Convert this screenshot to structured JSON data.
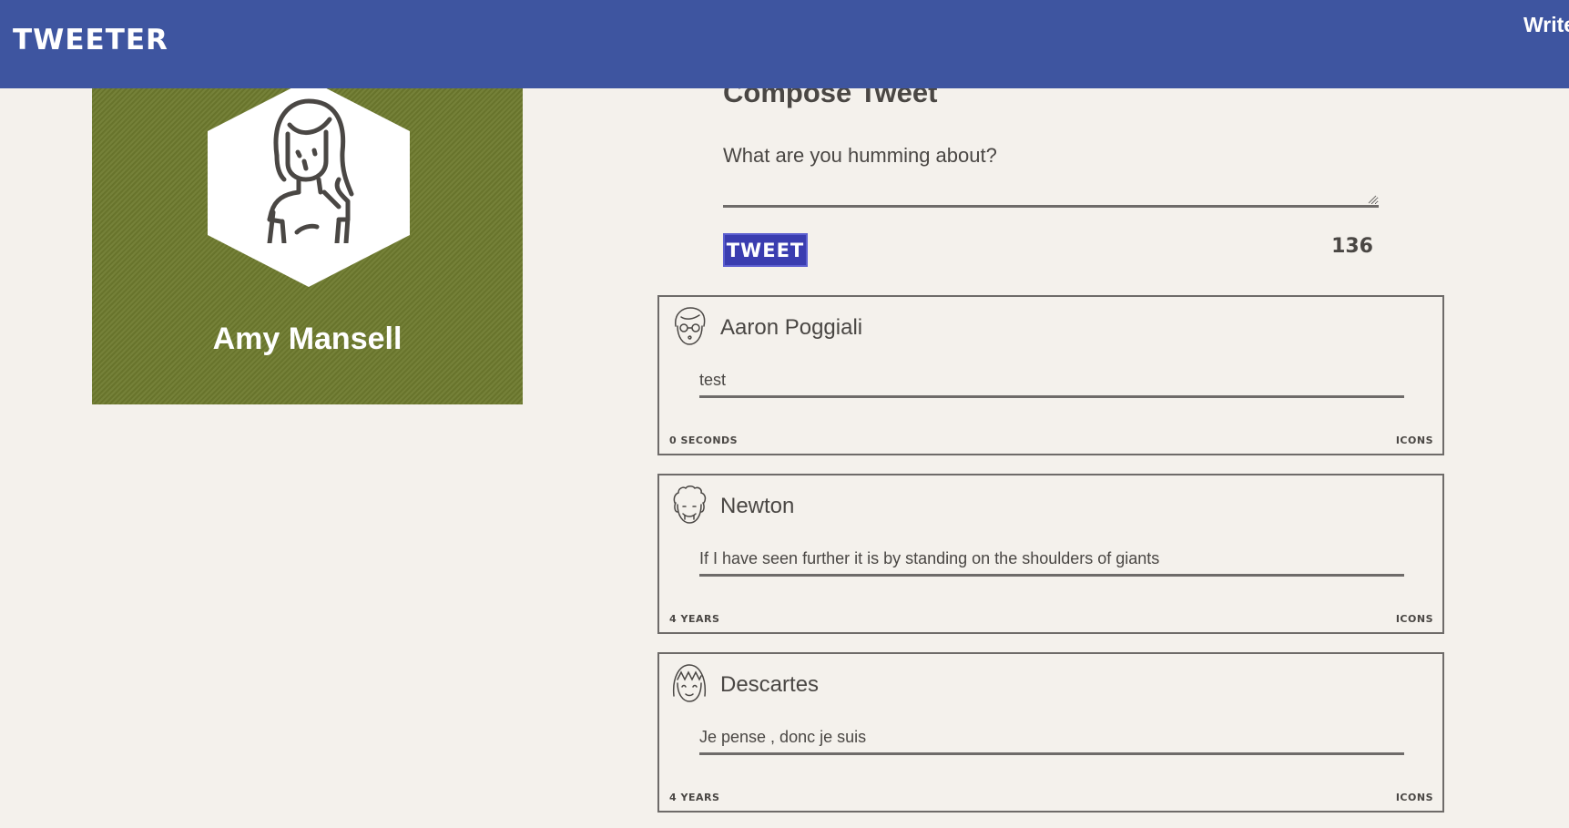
{
  "header": {
    "brand": "TWEETER",
    "link": "Write"
  },
  "profile": {
    "name": "Amy Mansell",
    "background_color": "#6e7a2e",
    "avatar_icon": "woman-avatar-icon"
  },
  "compose": {
    "title": "Compose Tweet",
    "prompt": "What are you humming about?",
    "text_value": "",
    "button_label": "TWEET",
    "char_count": "136"
  },
  "tweets": [
    {
      "author": "Aaron Poggiali",
      "message": "test",
      "age": "0 SECONDS",
      "icons_label": "ICONS",
      "avatar_icon": "man-glasses-avatar-icon"
    },
    {
      "author": "Newton",
      "message": "If I have seen further it is by standing on the shoulders of giants",
      "age": "4 YEARS",
      "icons_label": "ICONS",
      "avatar_icon": "curly-hair-avatar-icon"
    },
    {
      "author": "Descartes",
      "message": "Je pense , donc je suis",
      "age": "4 YEARS",
      "icons_label": "ICONS",
      "avatar_icon": "bangs-avatar-icon"
    }
  ],
  "colors": {
    "header": "#3e55a0",
    "button": "#3a3db0",
    "page_background": "#f4f1ec",
    "text": "#4a4744"
  }
}
